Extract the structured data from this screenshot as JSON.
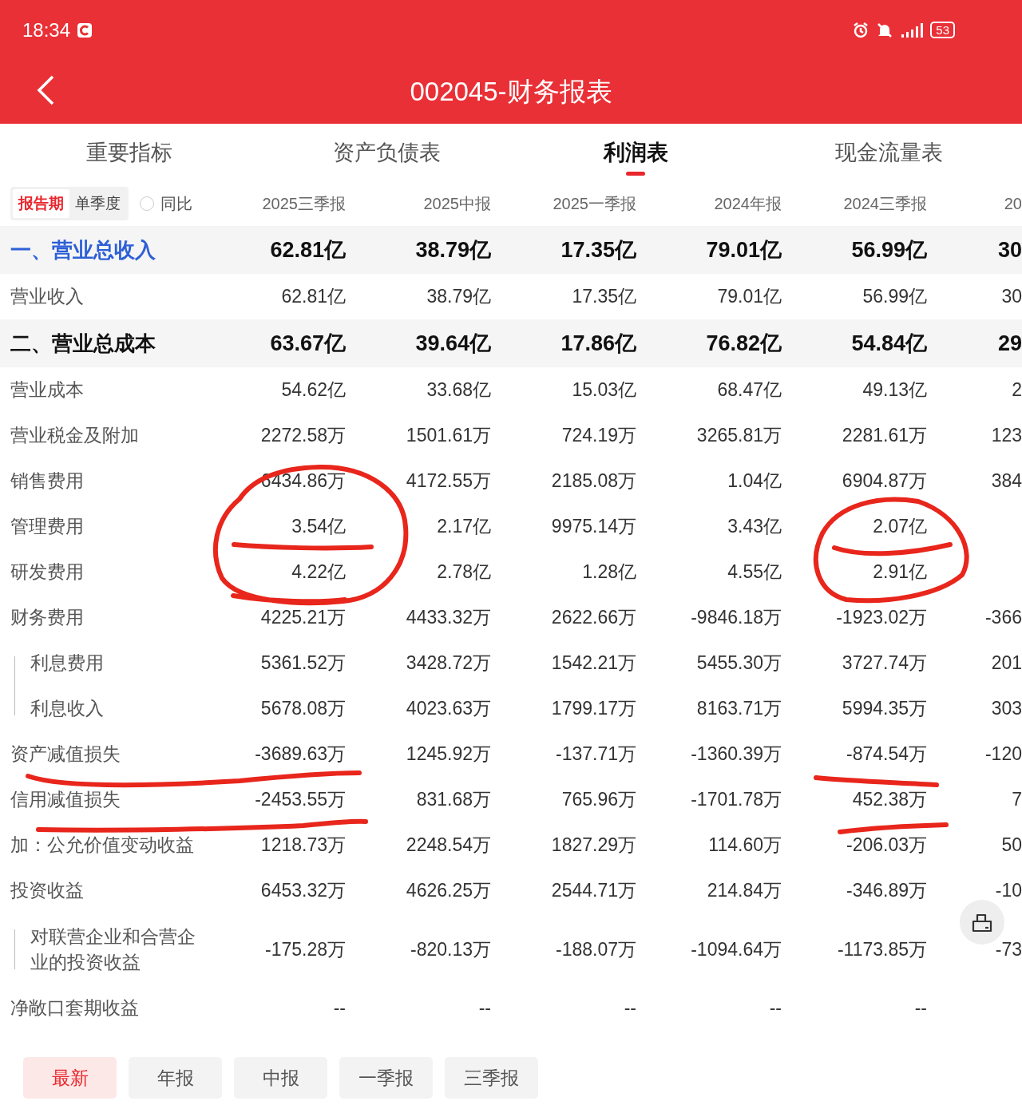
{
  "status_bar": {
    "time": "18:34",
    "battery": "53"
  },
  "header": {
    "title": "002045-财务报表"
  },
  "tabs": [
    {
      "label": "重要指标",
      "selected": false
    },
    {
      "label": "资产负债表",
      "selected": false
    },
    {
      "label": "利润表",
      "selected": true
    },
    {
      "label": "现金流量表",
      "selected": false
    }
  ],
  "period_toggle": [
    {
      "label": "报告期",
      "selected": true
    },
    {
      "label": "单季度",
      "selected": false
    }
  ],
  "yoy": {
    "label": "同比",
    "checked": false
  },
  "table": {
    "columns": [
      "2025三季报",
      "2025中报",
      "2025一季报",
      "2024年报",
      "2024三季报",
      "20"
    ],
    "rows": [
      {
        "label": "一、营业总收入",
        "kind": "section",
        "highlighted": true,
        "values": [
          "62.81亿",
          "38.79亿",
          "17.35亿",
          "79.01亿",
          "56.99亿",
          "30"
        ]
      },
      {
        "label": "营业收入",
        "kind": "item",
        "values": [
          "62.81亿",
          "38.79亿",
          "17.35亿",
          "79.01亿",
          "56.99亿",
          "30"
        ]
      },
      {
        "label": "二、营业总成本",
        "kind": "section",
        "highlighted": false,
        "values": [
          "63.67亿",
          "39.64亿",
          "17.86亿",
          "76.82亿",
          "54.84亿",
          "29"
        ]
      },
      {
        "label": "营业成本",
        "kind": "item",
        "values": [
          "54.62亿",
          "33.68亿",
          "15.03亿",
          "68.47亿",
          "49.13亿",
          "2"
        ]
      },
      {
        "label": "营业税金及附加",
        "kind": "item",
        "values": [
          "2272.58万",
          "1501.61万",
          "724.19万",
          "3265.81万",
          "2281.61万",
          "123"
        ]
      },
      {
        "label": "销售费用",
        "kind": "item",
        "values": [
          "6434.86万",
          "4172.55万",
          "2185.08万",
          "1.04亿",
          "6904.87万",
          "384"
        ]
      },
      {
        "label": "管理费用",
        "kind": "item",
        "values": [
          "3.54亿",
          "2.17亿",
          "9975.14万",
          "3.43亿",
          "2.07亿"
        ]
      },
      {
        "label": "研发费用",
        "kind": "item",
        "values": [
          "4.22亿",
          "2.78亿",
          "1.28亿",
          "4.55亿",
          "2.91亿"
        ]
      },
      {
        "label": "财务费用",
        "kind": "item",
        "values": [
          "4225.21万",
          "4433.32万",
          "2622.66万",
          "-9846.18万",
          "-1923.02万",
          "-366"
        ],
        "children": [
          {
            "label": "利息费用",
            "kind": "item",
            "values": [
              "5361.52万",
              "3428.72万",
              "1542.21万",
              "5455.30万",
              "3727.74万",
              "201"
            ]
          },
          {
            "label": "利息收入",
            "kind": "item",
            "values": [
              "5678.08万",
              "4023.63万",
              "1799.17万",
              "8163.71万",
              "5994.35万",
              "303"
            ]
          }
        ]
      },
      {
        "label": "资产减值损失",
        "kind": "item",
        "values": [
          "-3689.63万",
          "1245.92万",
          "-137.71万",
          "-1360.39万",
          "-874.54万",
          "-120"
        ]
      },
      {
        "label": "信用减值损失",
        "kind": "item",
        "values": [
          "-2453.55万",
          "831.68万",
          "765.96万",
          "-1701.78万",
          "452.38万",
          "7"
        ]
      },
      {
        "label": "加：公允价值变动收益",
        "kind": "item",
        "values": [
          "1218.73万",
          "2248.54万",
          "1827.29万",
          "114.60万",
          "-206.03万",
          "50"
        ]
      },
      {
        "label": "投资收益",
        "kind": "item",
        "values": [
          "6453.32万",
          "4626.25万",
          "2544.71万",
          "214.84万",
          "-346.89万",
          "-10"
        ],
        "children": [
          {
            "label": "对联营企业和合营企业的投资收益",
            "kind": "item",
            "values": [
              "-175.28万",
              "-820.13万",
              "-188.07万",
              "-1094.64万",
              "-1173.85万",
              "-73"
            ]
          }
        ]
      },
      {
        "label": "净敞口套期收益",
        "kind": "item",
        "values": [
          "--",
          "--",
          "--",
          "--",
          "--"
        ]
      }
    ]
  },
  "bottom_filters": [
    {
      "label": "最新",
      "selected": true
    },
    {
      "label": "年报",
      "selected": false
    },
    {
      "label": "中报",
      "selected": false
    },
    {
      "label": "一季报",
      "selected": false
    },
    {
      "label": "三季报",
      "selected": false
    }
  ]
}
